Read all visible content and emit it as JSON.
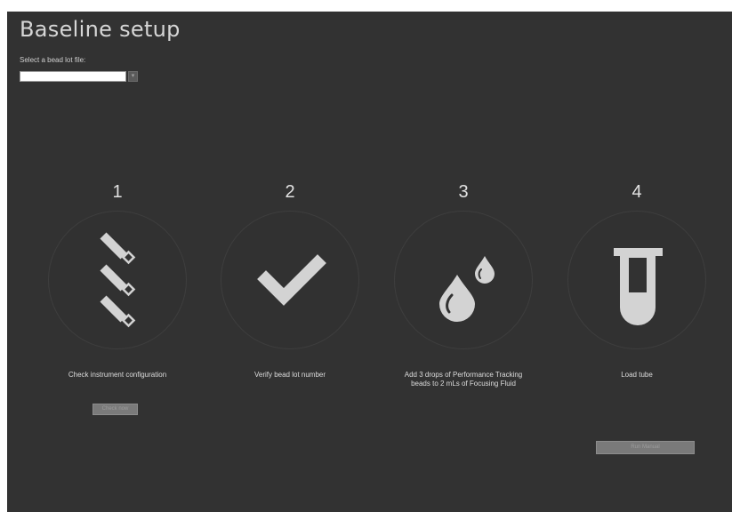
{
  "page": {
    "title": "Baseline setup",
    "select_label": "Select a bead lot file:",
    "select_value": ""
  },
  "steps": [
    {
      "number": "1",
      "label": "Check instrument configuration",
      "icon": "tubes-icon"
    },
    {
      "number": "2",
      "label": "Verify bead lot number",
      "icon": "checkmark-icon"
    },
    {
      "number": "3",
      "label": "Add 3 drops of Performance Tracking beads to 2 mLs of Focusing Fluid",
      "icon": "drops-icon"
    },
    {
      "number": "4",
      "label": "Load tube",
      "icon": "test-tube-icon"
    }
  ],
  "buttons": {
    "check_now": "Check now",
    "run_manual": "Run Manual"
  },
  "colors": {
    "background": "#323232",
    "icon": "#d3d3d3",
    "text": "#dcdcdc"
  }
}
